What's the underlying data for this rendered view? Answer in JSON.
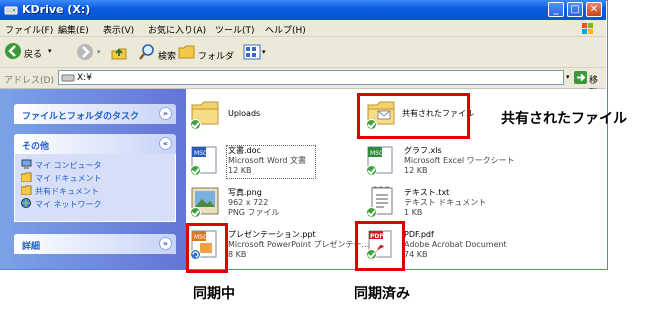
{
  "window": {
    "title": "KDrive (X:)",
    "controls": [
      "_",
      "□",
      "✕"
    ]
  },
  "menu": [
    "ファイル(F)",
    "編集(E)",
    "表示(V)",
    "お気に入り(A)",
    "ツール(T)",
    "ヘルプ(H)"
  ],
  "toolbar": {
    "back_label": "戻る",
    "search_label": "検索",
    "folders_label": "フォルダ"
  },
  "address": {
    "label": "アドレス(D)",
    "value": "X:¥",
    "go_label": "移動"
  },
  "sidebar": {
    "tasks_header": "ファイルとフォルダのタスク",
    "other_header": "その他",
    "other_items": [
      "マイ コンピュータ",
      "マイ ドキュメント",
      "共有ドキュメント",
      "マイ ネットワーク"
    ],
    "details_header": "詳細"
  },
  "files": [
    {
      "name": "Uploads",
      "line2": "",
      "line3": ""
    },
    {
      "name": "共有されたファイル",
      "line2": "",
      "line3": ""
    },
    {
      "name": "文書.doc",
      "line2": "Microsoft Word 文書",
      "line3": "12 KB"
    },
    {
      "name": "グラフ.xls",
      "line2": "Microsoft Excel ワークシート",
      "line3": "12 KB"
    },
    {
      "name": "写真.png",
      "line2": "962 x 722",
      "line3": "PNG ファイル"
    },
    {
      "name": "テキスト.txt",
      "line2": "テキスト ドキュメント",
      "line3": "1 KB"
    },
    {
      "name": "プレゼンテーション.ppt",
      "line2": "Microsoft PowerPoint プレゼンテー...",
      "line3": "8 KB"
    },
    {
      "name": "PDF.pdf",
      "line2": "Adobe Acrobat Document",
      "line3": "74 KB"
    }
  ],
  "annotations": {
    "shared_label": "共有されたファイル",
    "syncing_label": "同期中",
    "synced_label": "同期済み"
  },
  "colors": {
    "xp_blue": "#0a5ae0",
    "highlight_red": "#e00000",
    "sync_green": "#3da43d"
  }
}
